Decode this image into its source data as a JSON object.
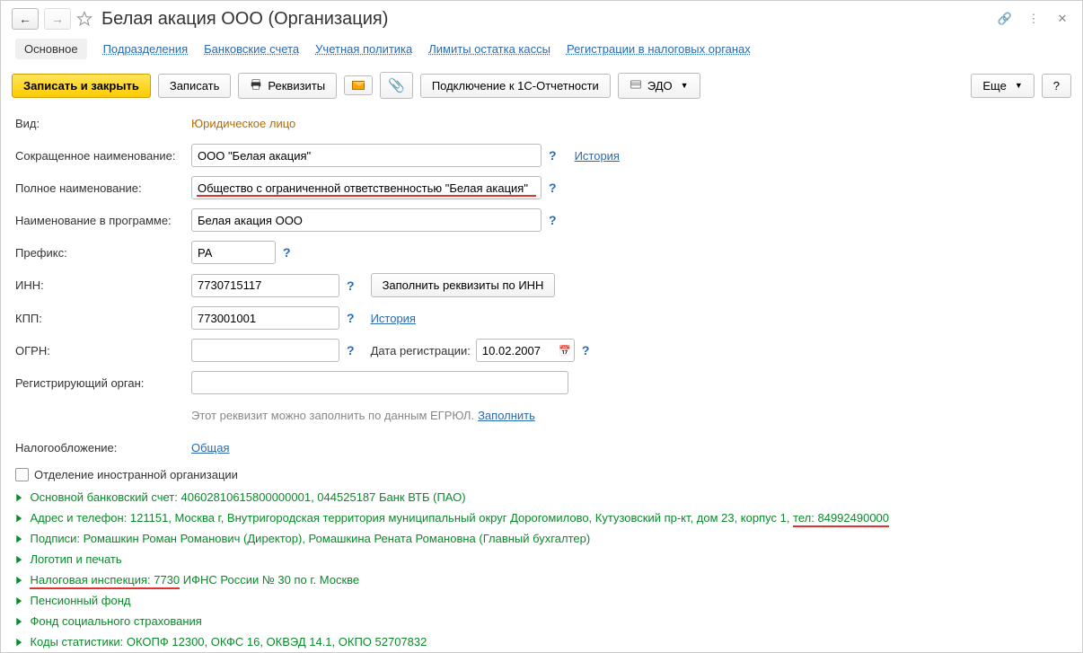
{
  "header": {
    "title": "Белая акация ООО (Организация)"
  },
  "tabs": {
    "main": "Основное",
    "subdiv": "Подразделения",
    "bank": "Банковские счета",
    "policy": "Учетная политика",
    "limits": "Лимиты остатка кассы",
    "taxreg": "Регистрации в налоговых органах"
  },
  "toolbar": {
    "save_close": "Записать и закрыть",
    "save": "Записать",
    "requisites": "Реквизиты",
    "connect": "Подключение к 1С-Отчетности",
    "edo": "ЭДО",
    "more": "Еще",
    "help": "?"
  },
  "form": {
    "kind_label": "Вид:",
    "kind_value": "Юридическое лицо",
    "short_label": "Сокращенное наименование:",
    "short_value": "ООО \"Белая акация\"",
    "history": "История",
    "full_label": "Полное наименование:",
    "full_value": "Общество с ограниченной ответственностью \"Белая акация\"",
    "prog_label": "Наименование в программе:",
    "prog_value": "Белая акация ООО",
    "prefix_label": "Префикс:",
    "prefix_value": "РА",
    "inn_label": "ИНН:",
    "inn_value": "7730715117",
    "inn_fill": "Заполнить реквизиты по ИНН",
    "kpp_label": "КПП:",
    "kpp_value": "773001001",
    "ogrn_label": "ОГРН:",
    "ogrn_value": "",
    "regdate_label": "Дата регистрации:",
    "regdate_value": "10.02.2007",
    "regorg_label": "Регистрирующий орган:",
    "regorg_value": "",
    "regorg_hint": "Этот реквизит можно заполнить по данным ЕГРЮЛ.",
    "regorg_fill": "Заполнить",
    "tax_label": "Налогообложение:",
    "tax_value": "Общая",
    "foreign_label": "Отделение иностранной организации"
  },
  "expand": {
    "bank": "Основной банковский счет: 40602810615800000001, 044525187 Банк ВТБ (ПАО)",
    "addr_1": "Адрес и телефон: 121151, Москва г, Внутригородская территория муниципальный округ Дорогомилово, Кутузовский пр-кт, дом 23, корпус 1, ",
    "addr_2": "тел: 84992490000",
    "sign": "Подписи: Ромашкин Роман Романович (Директор), Ромашкина Рената Романовна (Главный бухгалтер)",
    "logo": "Логотип и печать",
    "taxinsp_1": "Налоговая инспекция: 7730",
    "taxinsp_2": " ИФНС России № 30 по г. Москве",
    "pension": "Пенсионный фонд",
    "fss": "Фонд социального страхования",
    "codes": "Коды статистики: ОКОПФ 12300, ОКФС 16, ОКВЭД 14.1, ОКПО 52707832"
  }
}
